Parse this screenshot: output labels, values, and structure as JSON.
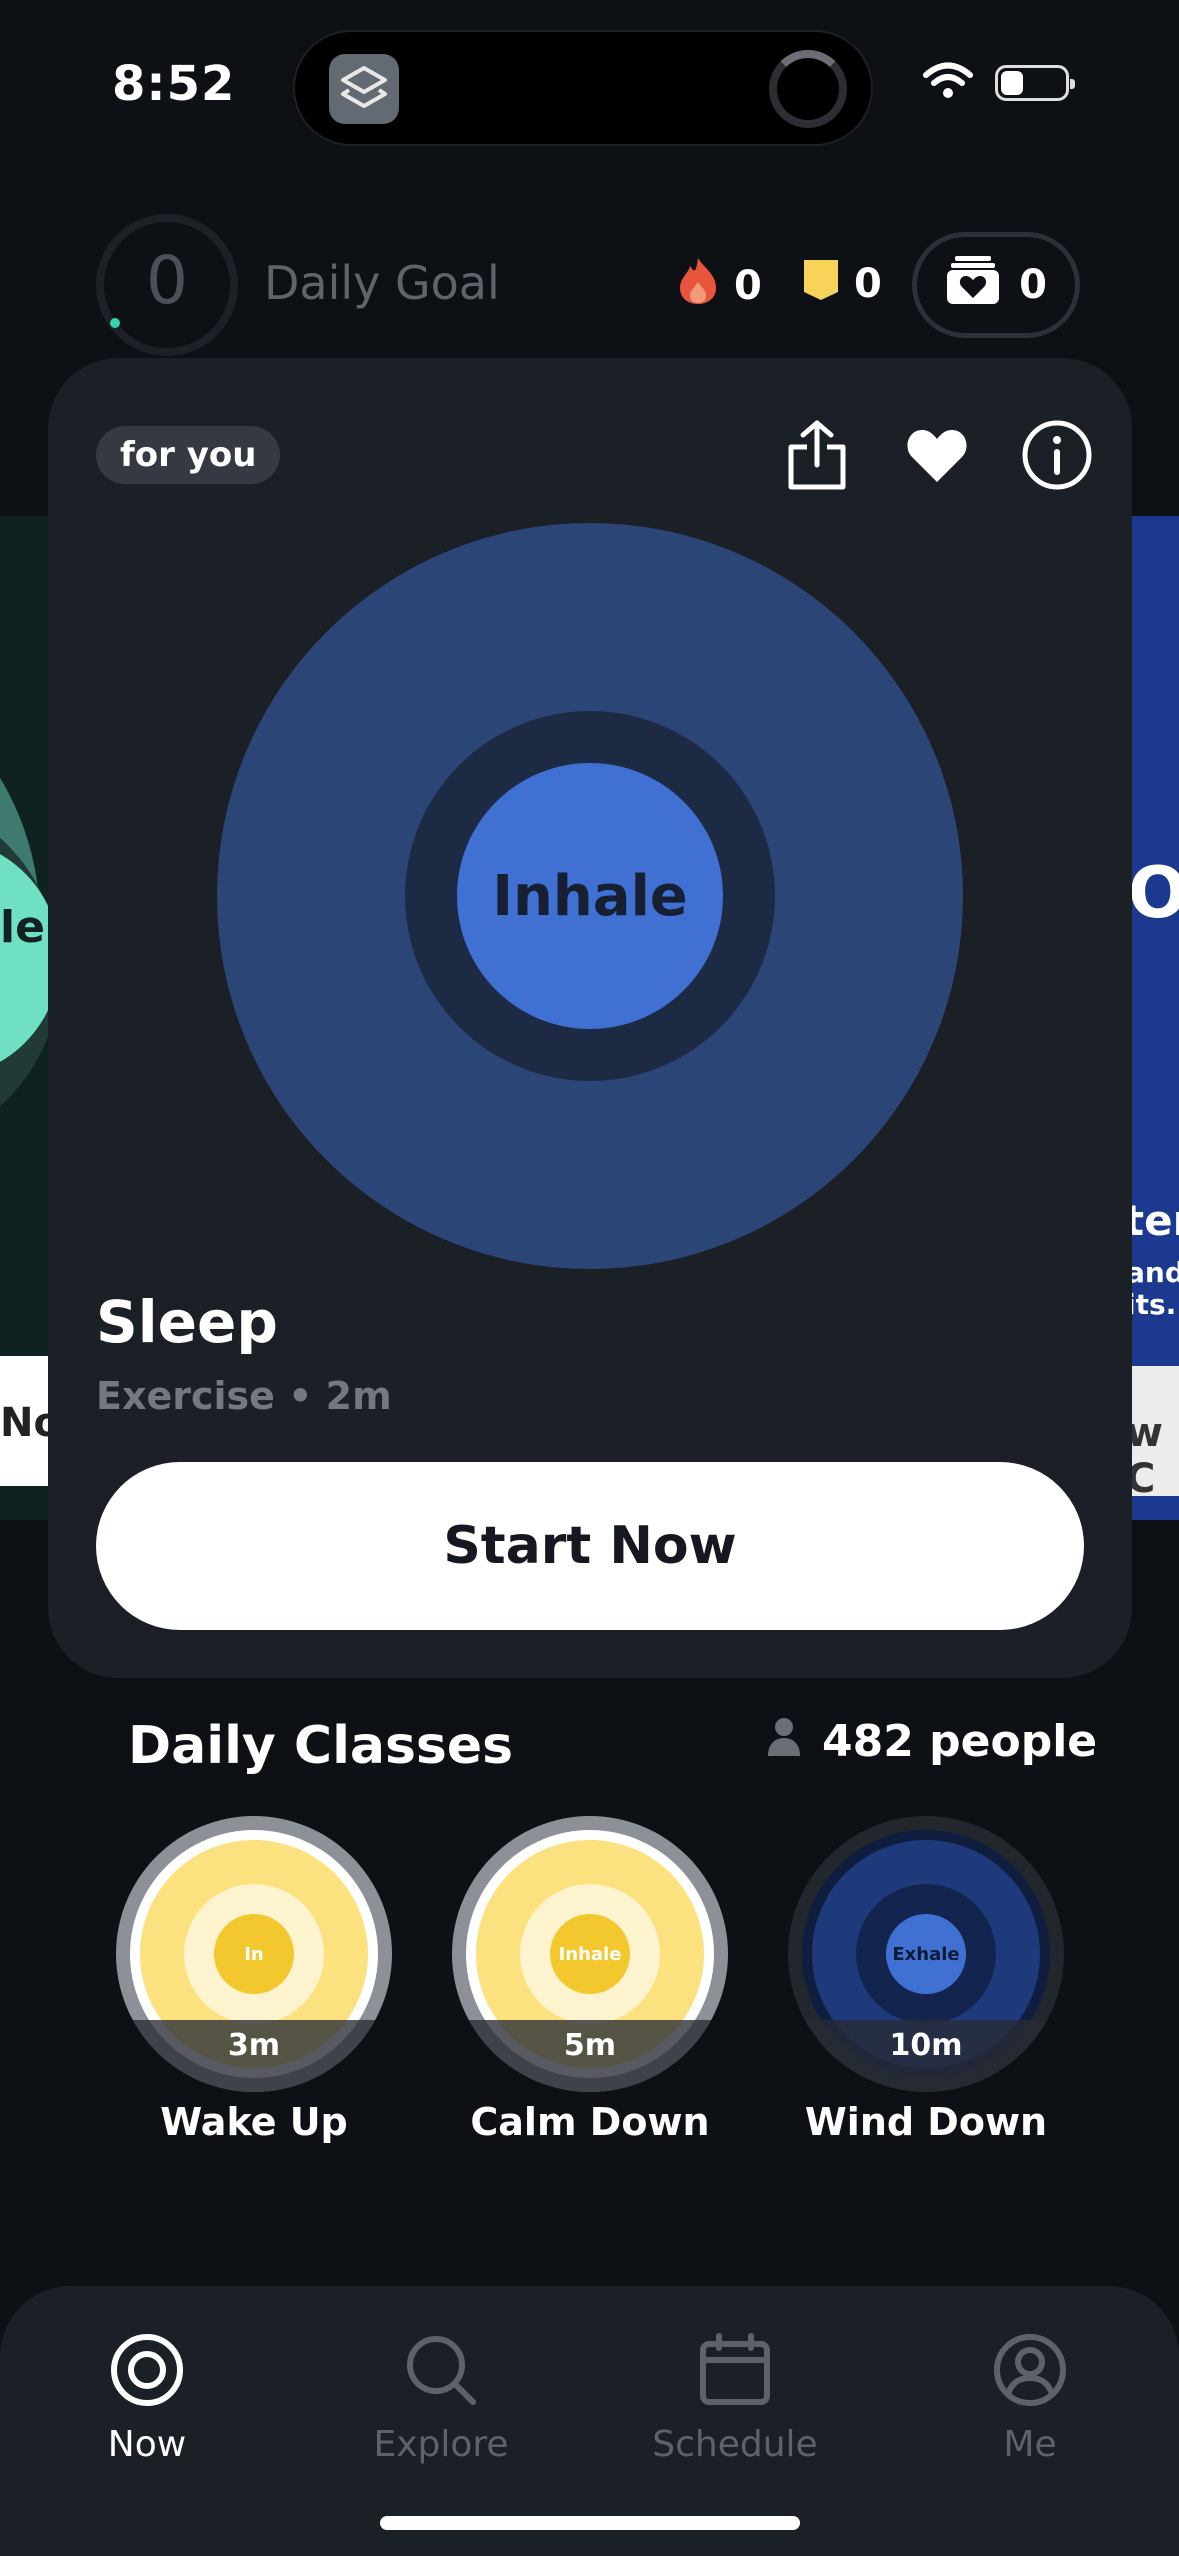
{
  "status_bar": {
    "time": "8:52"
  },
  "top_bar": {
    "goal_count": "0",
    "goal_label": "Daily Goal",
    "streak": "0",
    "badges": "0",
    "saved": "0"
  },
  "side_left": {
    "label": "le",
    "button": "Nov"
  },
  "side_right": {
    "letter": "O",
    "title": "ter",
    "sub1": "and",
    "sub2": "its.",
    "button": "w C"
  },
  "card": {
    "tag": "for you",
    "breath_label": "Inhale",
    "title": "Sleep",
    "subtitle": "Exercise • 2m",
    "start_button": "Start Now"
  },
  "daily_classes": {
    "title": "Daily Classes",
    "people": "482 people",
    "items": [
      {
        "name": "Wake Up",
        "duration": "3m",
        "core_label": "In"
      },
      {
        "name": "Calm Down",
        "duration": "5m",
        "core_label": "Inhale"
      },
      {
        "name": "Wind Down",
        "duration": "10m",
        "core_label": "Exhale"
      }
    ]
  },
  "tabs": [
    {
      "label": "Now",
      "icon": "target-icon",
      "active": true
    },
    {
      "label": "Explore",
      "icon": "search-icon",
      "active": false
    },
    {
      "label": "Schedule",
      "icon": "calendar-icon",
      "active": false
    },
    {
      "label": "Me",
      "icon": "profile-icon",
      "active": false
    }
  ],
  "colors": {
    "background": "#0d1014",
    "card": "#1b1f26",
    "breath_outer": "#2b4577",
    "breath_core": "#3f70d2",
    "accent_teal": "#33d2b0",
    "streak_flame": "#e8553c",
    "badge_yellow": "#f7d35a"
  }
}
